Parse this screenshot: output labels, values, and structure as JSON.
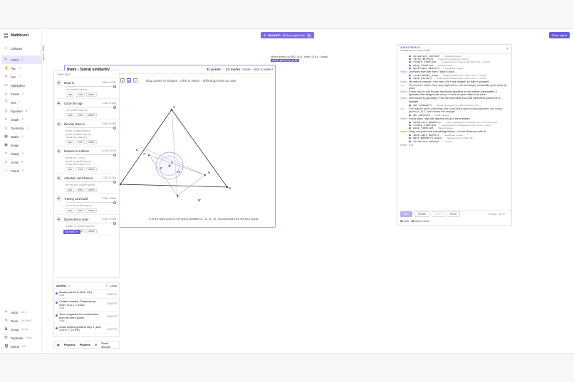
{
  "app": {
    "name": "Mathburst"
  },
  "header": {
    "mcp_label": "WebMCP",
    "mcp_status": "All live page tools",
    "close_agent": "Close agent"
  },
  "toolbar": {
    "collapse": "Collapse",
    "tools": [
      {
        "label": "Select",
        "key": "V",
        "icon": "cursor-icon",
        "glyph": "↖"
      },
      {
        "label": "Pan",
        "key": "H",
        "icon": "hand-icon",
        "glyph": "✋"
      },
      {
        "label": "Pen",
        "key": "P",
        "icon": "pen-icon",
        "glyph": "✎"
      },
      {
        "label": "Highlighter",
        "key": "",
        "icon": "highlighter-icon",
        "glyph": "▭"
      },
      {
        "label": "Eraser",
        "key": "E",
        "icon": "eraser-icon",
        "glyph": "◇"
      },
      {
        "label": "Text",
        "key": "T",
        "icon": "text-icon",
        "glyph": "T"
      },
      {
        "label": "Equation",
        "key": "M",
        "icon": "equation-icon",
        "glyph": "∑"
      },
      {
        "label": "Graph",
        "key": "G",
        "icon": "graph-icon",
        "glyph": "∿"
      },
      {
        "label": "Geometry",
        "key": "C",
        "icon": "geometry-icon",
        "glyph": "△"
      },
      {
        "label": "Matrix",
        "key": "X",
        "icon": "matrix-icon",
        "glyph": "▦"
      },
      {
        "label": "Image",
        "key": "",
        "icon": "image-icon",
        "glyph": "▣"
      },
      {
        "label": "Shape",
        "key": "S",
        "icon": "shape-icon",
        "glyph": "□"
      },
      {
        "label": "Arrow",
        "key": "A",
        "icon": "arrow-icon",
        "glyph": "↗"
      },
      {
        "label": "Frame",
        "key": "F",
        "icon": "frame-icon",
        "glyph": "⬚"
      }
    ],
    "bottom": [
      {
        "label": "Undo",
        "key": "Ctrl Z",
        "icon": "undo-icon",
        "glyph": "↶"
      },
      {
        "label": "Redo",
        "key": "Ctrl Shift Z",
        "icon": "redo-icon",
        "glyph": "↷"
      },
      {
        "label": "Group",
        "key": "Ctrl G",
        "icon": "group-icon",
        "glyph": "⧉"
      },
      {
        "label": "Duplicate",
        "key": "Ctrl D",
        "icon": "duplicate-icon",
        "glyph": "⎘"
      },
      {
        "label": "Delete",
        "key": "Del",
        "icon": "trash-icon",
        "glyph": "🗑"
      }
    ]
  },
  "vertical_tabs": [
    "Tools",
    "Agent"
  ],
  "timelines": {
    "header": "TIMELINES",
    "items": [
      {
        "name": "Draw in",
        "time": "3.00s / 3.00s",
        "progress": [
          "cue.drawProgress"
        ]
      },
      {
        "name": "Circle the sign",
        "time": "1.20s / 1.20s",
        "progress": [
          "cue.drawProgress"
        ]
      },
      {
        "name": "Density draw-in",
        "time": "5.00s / 5.00s",
        "progress": [
          "graph.drawProgress",
          "graph.shapeProgress",
          "equation.opacity"
        ]
      },
      {
        "name": "Masses to softmax",
        "time": "4.70s / 4.70s",
        "progress": [
          "equation.latex",
          "graph.shapeProgress",
          "graph.parameters.k"
        ]
      },
      {
        "name": "Attention card draw-in",
        "time": "1.20s / 1.20s",
        "progress": [
          "attention.drawProgress"
        ]
      },
      {
        "name": "Tracing card build",
        "time": "3.60s / 3.60s",
        "progress": [
          "tracing.drawProgress"
        ]
      },
      {
        "name": "Dependency order",
        "time": "4.40s / 4.40s",
        "progress": [
          "geometry.drawProgress"
        ]
      }
    ],
    "btn_loop": "loop",
    "btn_reset": "reset",
    "btn_delete": "delete",
    "moving_badge": "MOVING"
  },
  "activity": {
    "title": "Activity",
    "count": "23",
    "undo": "Undo",
    "items": [
      {
        "text": "Moved point A to (592, 411)",
        "who": "Tutor",
        "time": "08:58 PM"
      },
      {
        "text": "Created timeline \"Dependency order\" (4.6 s, 1 track)",
        "who": "Tutor",
        "time": "08:58 PM"
      },
      {
        "text": "Tutor completed the construction from the three points",
        "who": "Tutor",
        "time": "08:58 PM"
      },
      {
        "text": "Undid applied gradient step 1 (loss 1.01% → 0.76%)",
        "who": "",
        "time": "02:52 PM"
      }
    ]
  },
  "bottombar": {
    "projects": "Projects",
    "pipeline": "Pipeline",
    "blank_canvas": "Blank canvas"
  },
  "document": {
    "title": "thety - Spiral similarity",
    "points": "11 points",
    "marks": "13 marks",
    "move_hint": "move - click to select",
    "hint": "drag points or shapes - click to select - shift-drag locks an axis",
    "caption": "S is the fixed point of the spiral similarity A→A', B→B', recomputed from the four points",
    "tooltip_title": "Tutor",
    "tooltip_text": "Moved point A to (592, 411)",
    "coord": "(0, 4)",
    "labels": [
      "C",
      "A",
      "A'",
      "B",
      "B'",
      "P",
      "S",
      "M'",
      "N",
      "E",
      "F"
    ]
  },
  "status": {
    "line1": "Moved point A to (592, 411) · order\" (4.6 s, 1 track)",
    "tag": "move_geometry_point"
  },
  "agent": {
    "title": "AGENT REPLAY",
    "subtitle": "scripted events, real tool calls",
    "log": [
      {
        "k": "call",
        "name": "visualize_concept",
        "desc": "Visualized tracing"
      },
      {
        "k": "call",
        "name": "focus_objects",
        "desc": "Framed the network on 1 object"
      },
      {
        "k": "call",
        "name": "create_timeline",
        "desc": "Created timeline \"Tracing card build\" (4.2 s, 1 track)"
      },
      {
        "k": "call",
        "name": "play_timeline",
        "desc": "Played timeline"
      },
      {
        "k": "call",
        "name": "spotlight_objects",
        "desc": "Spotlighted 1 object"
      },
      {
        "k": "msg",
        "role": "TUTOR",
        "text": "One step from me, then I take it back."
      },
      {
        "k": "call",
        "name": "train_model_step",
        "desc": "Applied gradient step 1 (loss 1.01% → 0.76%)"
      },
      {
        "k": "call",
        "name": "step_history",
        "desc": "Undid applied gradient step 1 (loss 1.01% → 0.76%)"
      },
      {
        "k": "msg",
        "role": "TUTOR",
        "text": "My step is undone. Your turn. It's a real widget, so train it yourself."
      },
      {
        "k": "you",
        "role": "YOU",
        "text": "The learner clicks Train step eight times, too and target probability grew point by point."
      },
      {
        "k": "msg",
        "role": "TUTOR",
        "text": "Every click is one honest numerical gradient on the visible parameters. I operated this widget with a tool; it runs on pure math from here."
      },
      {
        "k": "msg",
        "role": "TUTOR",
        "text": "Let's move to geometry. Pick the Geometry tool and click three points for a triangle."
      },
      {
        "k": "call",
        "name": "set_viewport",
        "desc": "Moved the viewport to (-380, -1510) at 1.05×"
      },
      {
        "k": "you",
        "role": "YOU",
        "text": "The learner picks Geometry; the GeoGebra-style toolbar appears; the cursor places A, B, C and closes the triangle."
      },
      {
        "k": "call",
        "name": "get_objects",
        "desc": "Read 3 objects"
      },
      {
        "k": "msg",
        "role": "TUTOR",
        "text": "Every mark I add will depend on your three points."
      },
      {
        "k": "call",
        "name": "construct_geometry",
        "desc": "Tutor completed the construction from the three points"
      },
      {
        "k": "call",
        "name": "create_timeline",
        "desc": "Created timeline \"Dependency order\" (4.6 s, 1 track)"
      },
      {
        "k": "call",
        "name": "play_timeline",
        "desc": "Played timeline"
      },
      {
        "k": "msg",
        "role": "TUTOR",
        "text": "Drag one point and everything follows. Let me show you with A."
      },
      {
        "k": "call",
        "name": "spotlight_objects",
        "desc": "Spotlighted 1 object"
      },
      {
        "k": "call",
        "name": "move_geometry_point",
        "desc": "Moved point A to (592, 411)"
      },
      {
        "k": "call",
        "name": "visualize_concept",
        "desc": "running"
      },
      {
        "k": "msg",
        "role": "TUTOR",
        "text": "• • •"
      }
    ],
    "controls": {
      "run": "Run",
      "pause": "Pause",
      "step": "Step",
      "reset": "Reset",
      "turn": "turning · 34 / 37"
    },
    "footer_calls": "52",
    "footer_calls_label": "calls ·",
    "footer_tools": "26",
    "footer_tools_label": "distinct tools"
  },
  "colors": {
    "accent": "#6a5ed8",
    "accent_light": "#e8e6fb",
    "construction": "#9d8ff0"
  }
}
